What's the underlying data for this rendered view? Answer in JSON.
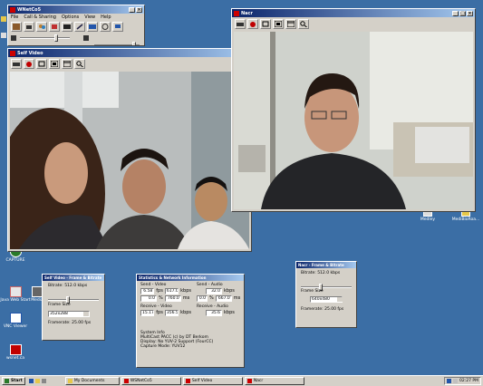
{
  "colors": {
    "desktop": "#3b6ea5",
    "title_active": "#0a246a",
    "record": "#c00000"
  },
  "main_app": {
    "title": "WNetCo5",
    "menu": [
      "File",
      "Call & Sharing",
      "Options",
      "View",
      "Help"
    ]
  },
  "remote_video": {
    "title": "Nacr"
  },
  "self_video": {
    "title": "Self Video"
  },
  "desktop_icons": [
    {
      "label": "CAPTURE",
      "icon": "capture-icon"
    },
    {
      "label": "Java Web Start",
      "icon": "java-icon"
    },
    {
      "label": "VNC Viewer",
      "icon": "vnc-icon"
    },
    {
      "label": "wsnet.ca",
      "icon": "app-icon"
    },
    {
      "label": "Media",
      "icon": "media-icon"
    },
    {
      "label": "Medley",
      "icon": "medley-icon"
    },
    {
      "label": "MediBioRoa...",
      "icon": "folder-icon"
    }
  ],
  "send_panel": {
    "title": "Self Video - Frame & Bitrate",
    "bitrate_label": "Bitrate: 512.0 kbps",
    "frame_size_label": "Frame Size",
    "frame_size_value": "352x288",
    "framerate_label": "Framerate: 25.00 fps"
  },
  "stats_panel": {
    "title": "Statistics & Network Information",
    "send_video_label": "Send - Video",
    "send_audio_label": "Send - Audio",
    "receive_video_label": "Receive - Video",
    "receive_audio_label": "Receive - Audio",
    "send_video": [
      {
        "value": "6.58",
        "unit": "fps"
      },
      {
        "value": "617.0",
        "unit": "kbps"
      },
      {
        "value": "0.0",
        "unit": "%"
      },
      {
        "value": "760.0",
        "unit": "ms"
      }
    ],
    "send_audio": [
      {
        "value": "32.0",
        "unit": "kbps"
      },
      {
        "value": "0.0",
        "unit": "%"
      },
      {
        "value": "667.0",
        "unit": "ms"
      }
    ],
    "receive_video": [
      {
        "value": "15.17",
        "unit": "fps"
      },
      {
        "value": "356.5",
        "unit": "kbps"
      }
    ],
    "receive_audio": [
      {
        "value": "35.6",
        "unit": "kbps"
      }
    ],
    "system_info_label": "System Info",
    "system_info": [
      "MultiCast        PACC (c) by DT Berkom",
      "Display: No YUV-2 Support (FourCC)",
      "Capture Mode: YUV12"
    ]
  },
  "remote_panel": {
    "title": "Nacr - Frame & Bitrate",
    "bitrate_label": "Bitrate: 512.0 kbps",
    "frame_size_label": "Frame Size",
    "frame_size_value": "640x480",
    "framerate_label": "Framerate: 25.00 fps"
  },
  "taskbar": {
    "start_label": "Start",
    "tasks": [
      "My Documents",
      "WSNetCo5",
      "Self Video",
      "Nacr"
    ],
    "clock": "02:27 PM"
  }
}
